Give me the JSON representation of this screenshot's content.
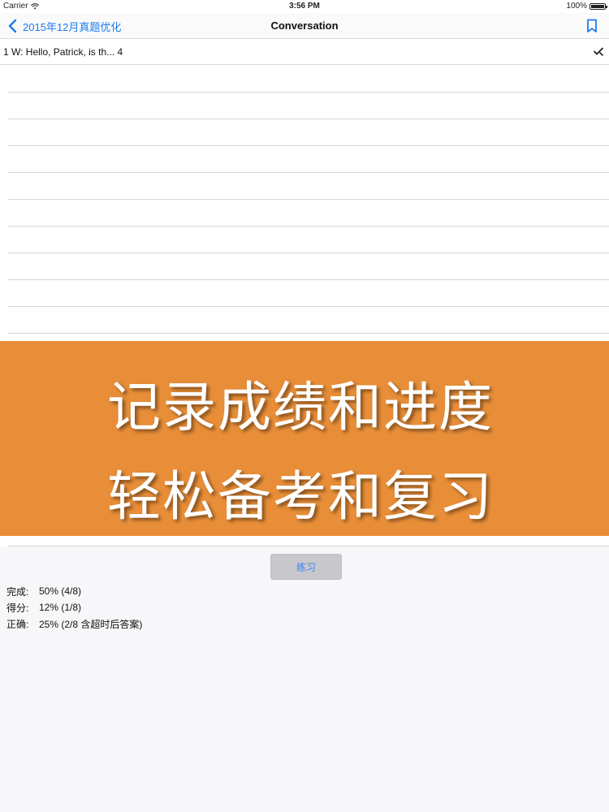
{
  "status_bar": {
    "carrier": "Carrier",
    "time": "3:56 PM",
    "battery": "100%",
    "battery_level": 1.0
  },
  "nav": {
    "back_label": "2015年12月真题优化",
    "title": "Conversation",
    "bookmark_icon": "bookmark-icon",
    "accent_color": "#1b7cf4"
  },
  "list": {
    "items": [
      {
        "text": "1 W: Hello, Patrick, is th... 4",
        "icon": "checkmark-icon"
      }
    ]
  },
  "banner": {
    "line1": "记录成绩和进度",
    "line2": "轻松备考和复习",
    "background_color": "#e88e38"
  },
  "practice": {
    "button_label": "练习"
  },
  "stats": {
    "rows": [
      {
        "label": "完成:",
        "value": "50% (4/8)"
      },
      {
        "label": "得分:",
        "value": "12% (1/8)"
      },
      {
        "label": "正确:",
        "value": "25% (2/8 含超时后答案)"
      }
    ]
  }
}
